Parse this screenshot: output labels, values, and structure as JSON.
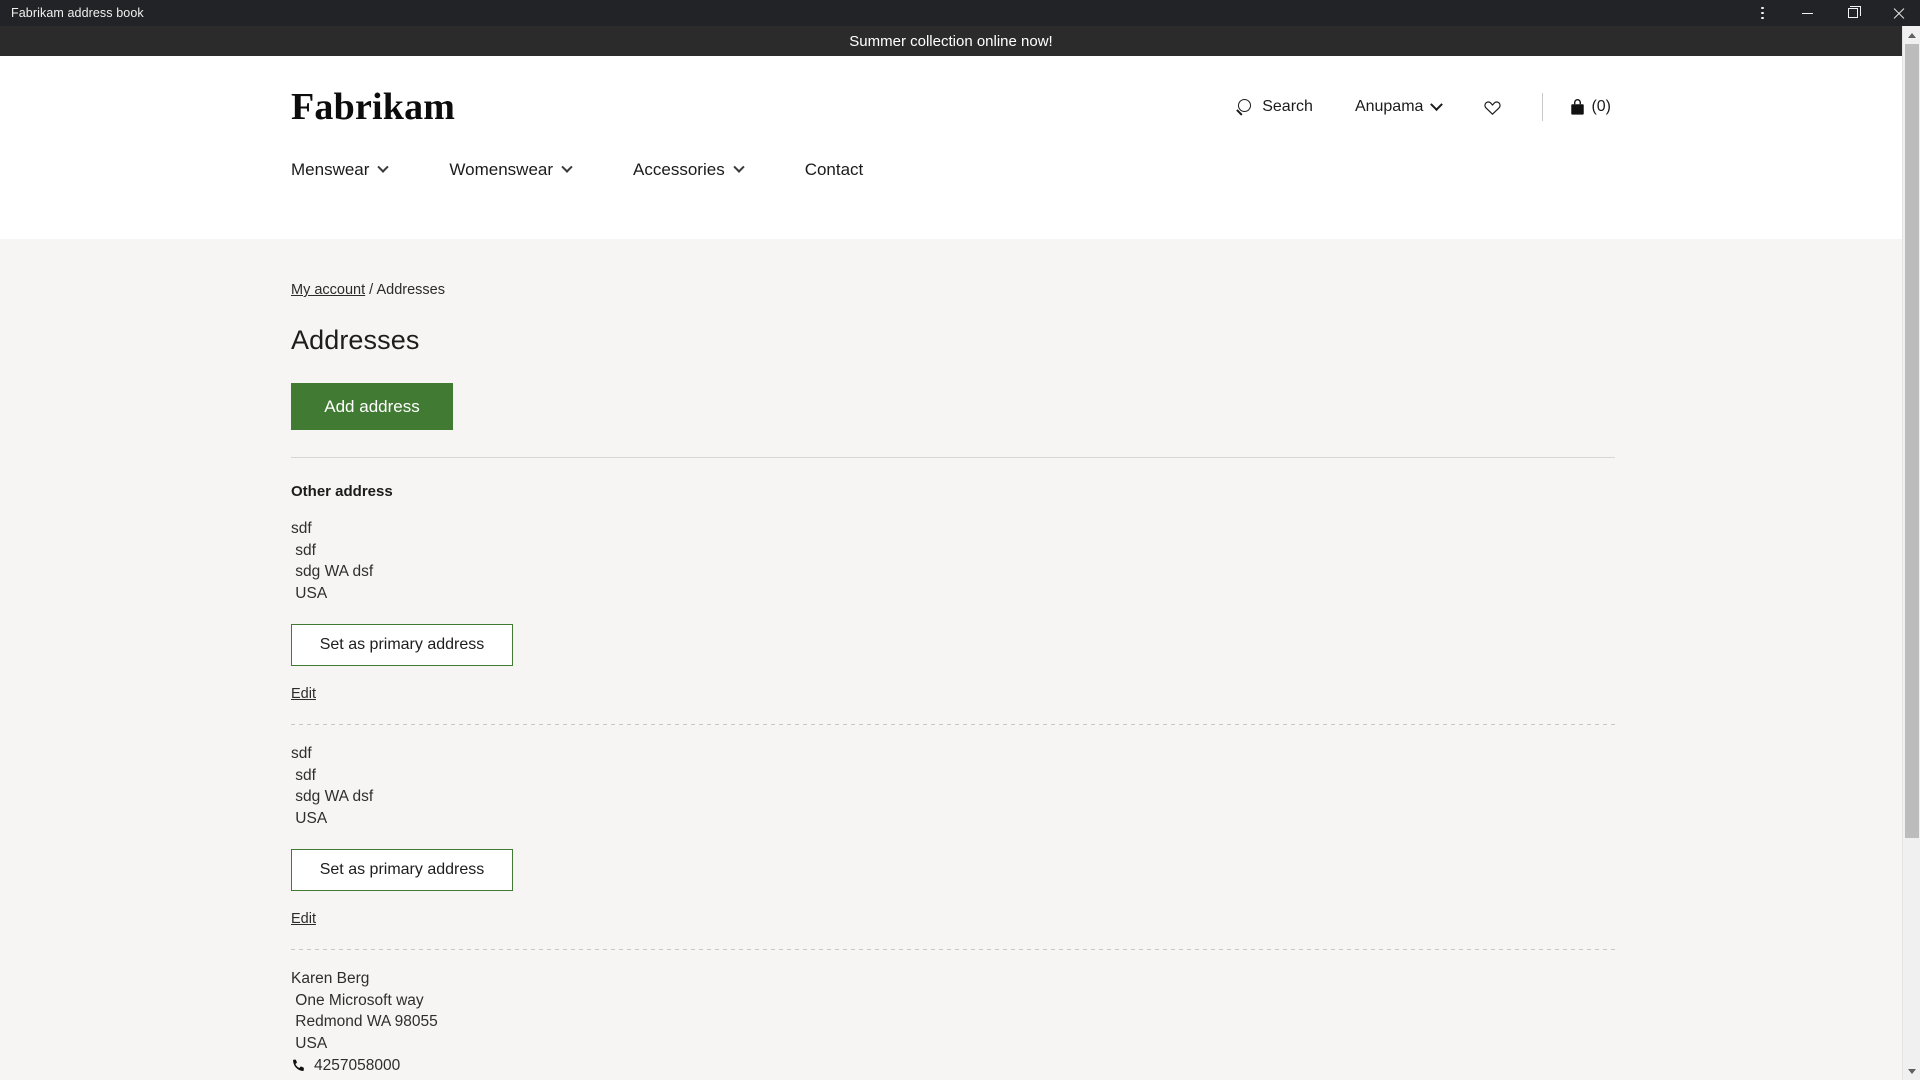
{
  "window": {
    "title": "Fabrikam address book",
    "controls": {
      "menu": "⋮",
      "minimize": "—",
      "maximize": "❐",
      "close": "✕"
    }
  },
  "promo": {
    "text": "Summer collection online now!"
  },
  "header": {
    "logo": "Fabrikam",
    "search_label": "Search",
    "account_label": "Anupama",
    "wishlist_icon": "heart-icon",
    "cart_icon": "shopping-bag-icon",
    "cart_count": "(0)"
  },
  "nav": {
    "items": [
      {
        "label": "Menswear",
        "has_dropdown": true
      },
      {
        "label": "Womenswear",
        "has_dropdown": true
      },
      {
        "label": "Accessories",
        "has_dropdown": true
      },
      {
        "label": "Contact",
        "has_dropdown": false
      }
    ]
  },
  "breadcrumb": {
    "parent": "My account",
    "separator": "/",
    "current": "Addresses"
  },
  "main": {
    "title": "Addresses",
    "add_address_label": "Add address",
    "section_label": "Other address",
    "set_primary_label": "Set as primary address",
    "edit_label": "Edit",
    "addresses": [
      {
        "lines": [
          "sdf",
          " sdf",
          " sdg WA dsf",
          " USA"
        ],
        "phone": null
      },
      {
        "lines": [
          "sdf",
          " sdf",
          " sdg WA dsf",
          " USA"
        ],
        "phone": null
      },
      {
        "lines": [
          "Karen Berg",
          " One Microsoft way",
          " Redmond WA 98055",
          " USA"
        ],
        "phone": "4257058000"
      }
    ]
  },
  "colors": {
    "accent_green": "#417a33",
    "titlebar": "#222326",
    "promo_bar": "#2b2b2b",
    "page_background": "#f6f5f3"
  },
  "scrollbar": {
    "up_arrow": "scroll-up-arrow",
    "down_arrow": "scroll-down-arrow",
    "thumb_percent": "78"
  }
}
